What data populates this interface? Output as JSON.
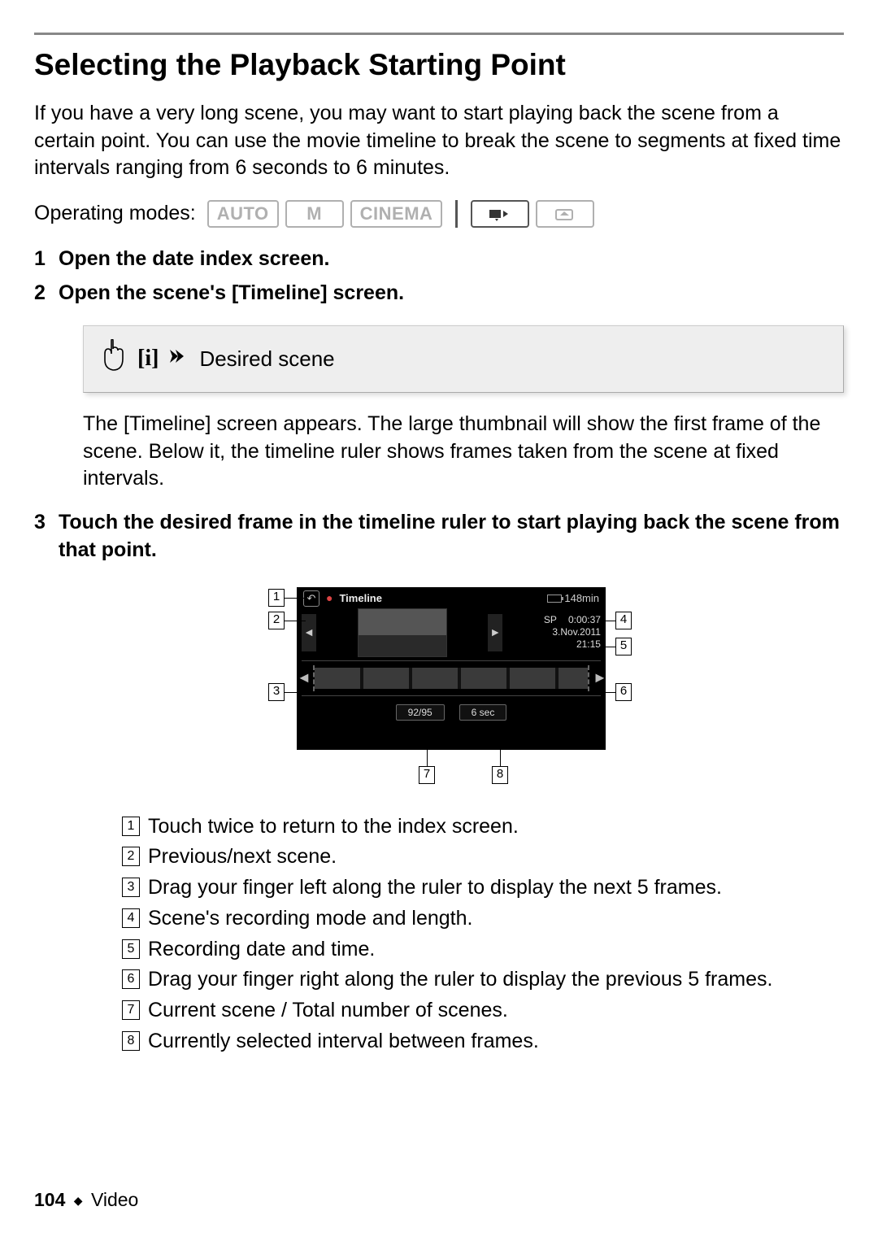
{
  "header": {
    "title": "Selecting the Playback Starting Point"
  },
  "intro": "If you have a very long scene, you may want to start playing back the scene from a certain point. You can use the movie timeline to break the scene to segments at fixed time intervals ranging from 6 seconds to 6 minutes.",
  "modes": {
    "label": "Operating modes:",
    "auto": "AUTO",
    "manual": "M",
    "cinema": "CINEMA"
  },
  "steps": {
    "s1": "Open the date index screen.",
    "s2": "Open the scene's [Timeline] screen.",
    "s2_callout_info": "[i]",
    "s2_callout_text": "Desired scene",
    "s2_desc": "The [Timeline] screen appears. The large thumbnail will show the first frame of the scene. Below it, the timeline ruler shows frames taken from the scene at fixed intervals.",
    "s3": "Touch the desired frame in the timeline ruler to start playing back the scene from that point."
  },
  "diagram": {
    "title": "Timeline",
    "battery_time": "148min",
    "rec_mode": "SP",
    "length": "0:00:37",
    "date": "3.Nov.2011",
    "time": "21:15",
    "scene_counter": "92/95",
    "interval": "6 sec"
  },
  "legend": {
    "n1": "Touch twice to return to the index screen.",
    "n2": "Previous/next scene.",
    "n3": "Drag your finger left along the ruler to display the next 5 frames.",
    "n4": "Scene's recording mode and length.",
    "n5": "Recording date and time.",
    "n6": "Drag your finger right along the ruler to display the previous 5 frames.",
    "n7": "Current scene / Total number of scenes.",
    "n8": "Currently selected interval between frames."
  },
  "footer": {
    "page": "104",
    "section": "Video"
  }
}
